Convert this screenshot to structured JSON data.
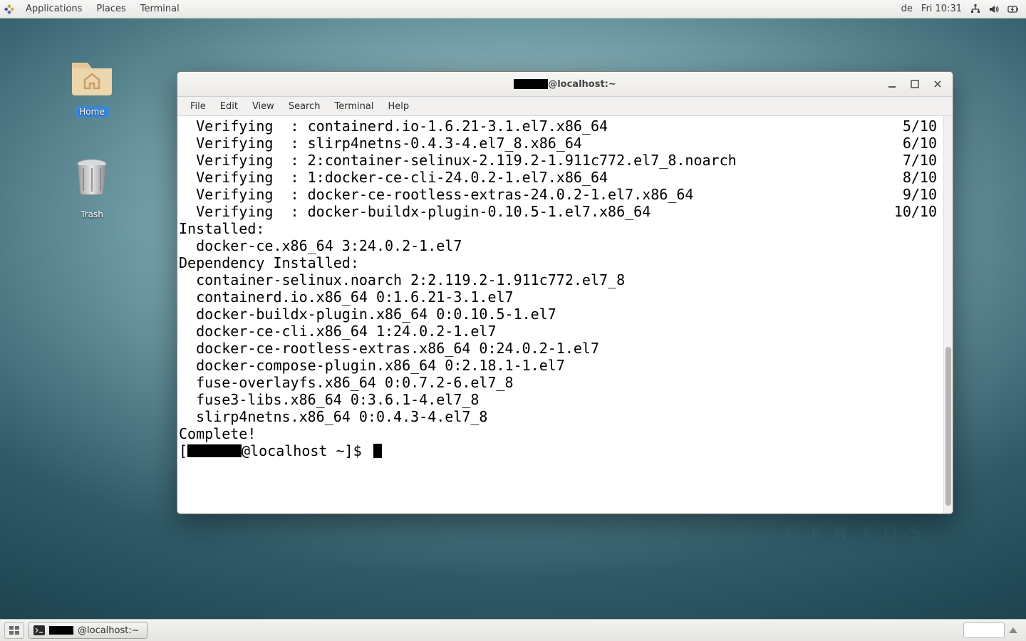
{
  "topbar": {
    "menus": [
      "Applications",
      "Places",
      "Terminal"
    ],
    "kb_layout": "de",
    "clock": "Fri 10:31"
  },
  "desktop_icons": {
    "home": "Home",
    "trash": "Trash"
  },
  "watermark": "CENTOS",
  "window": {
    "title_suffix": "@localhost:~",
    "menubar": [
      "File",
      "Edit",
      "View",
      "Search",
      "Terminal",
      "Help"
    ]
  },
  "terminal": {
    "verify_rows": [
      {
        "l": "  Verifying  : containerd.io-1.6.21-3.1.el7.x86_64",
        "r": "5/10"
      },
      {
        "l": "  Verifying  : slirp4netns-0.4.3-4.el7_8.x86_64",
        "r": "6/10"
      },
      {
        "l": "  Verifying  : 2:container-selinux-2.119.2-1.911c772.el7_8.noarch",
        "r": "7/10"
      },
      {
        "l": "  Verifying  : 1:docker-ce-cli-24.0.2-1.el7.x86_64",
        "r": "8/10"
      },
      {
        "l": "  Verifying  : docker-ce-rootless-extras-24.0.2-1.el7.x86_64",
        "r": "9/10"
      },
      {
        "l": "  Verifying  : docker-buildx-plugin-0.10.5-1.el7.x86_64",
        "r": "10/10"
      }
    ],
    "installed_header": "Installed:",
    "installed": [
      "  docker-ce.x86_64 3:24.0.2-1.el7"
    ],
    "dep_header": "Dependency Installed:",
    "deps": [
      "  container-selinux.noarch 2:2.119.2-1.911c772.el7_8",
      "  containerd.io.x86_64 0:1.6.21-3.1.el7",
      "  docker-buildx-plugin.x86_64 0:0.10.5-1.el7",
      "  docker-ce-cli.x86_64 1:24.0.2-1.el7",
      "  docker-ce-rootless-extras.x86_64 0:24.0.2-1.el7",
      "  docker-compose-plugin.x86_64 0:2.18.1-1.el7",
      "  fuse-overlayfs.x86_64 0:0.7.2-6.el7_8",
      "  fuse3-libs.x86_64 0:3.6.1-4.el7_8",
      "  slirp4netns.x86_64 0:0.4.3-4.el7_8"
    ],
    "complete": "Complete!",
    "prompt_prefix": "[",
    "prompt_suffix": "@localhost ~]$ "
  },
  "taskbar": {
    "task_suffix": "@localhost:~"
  }
}
